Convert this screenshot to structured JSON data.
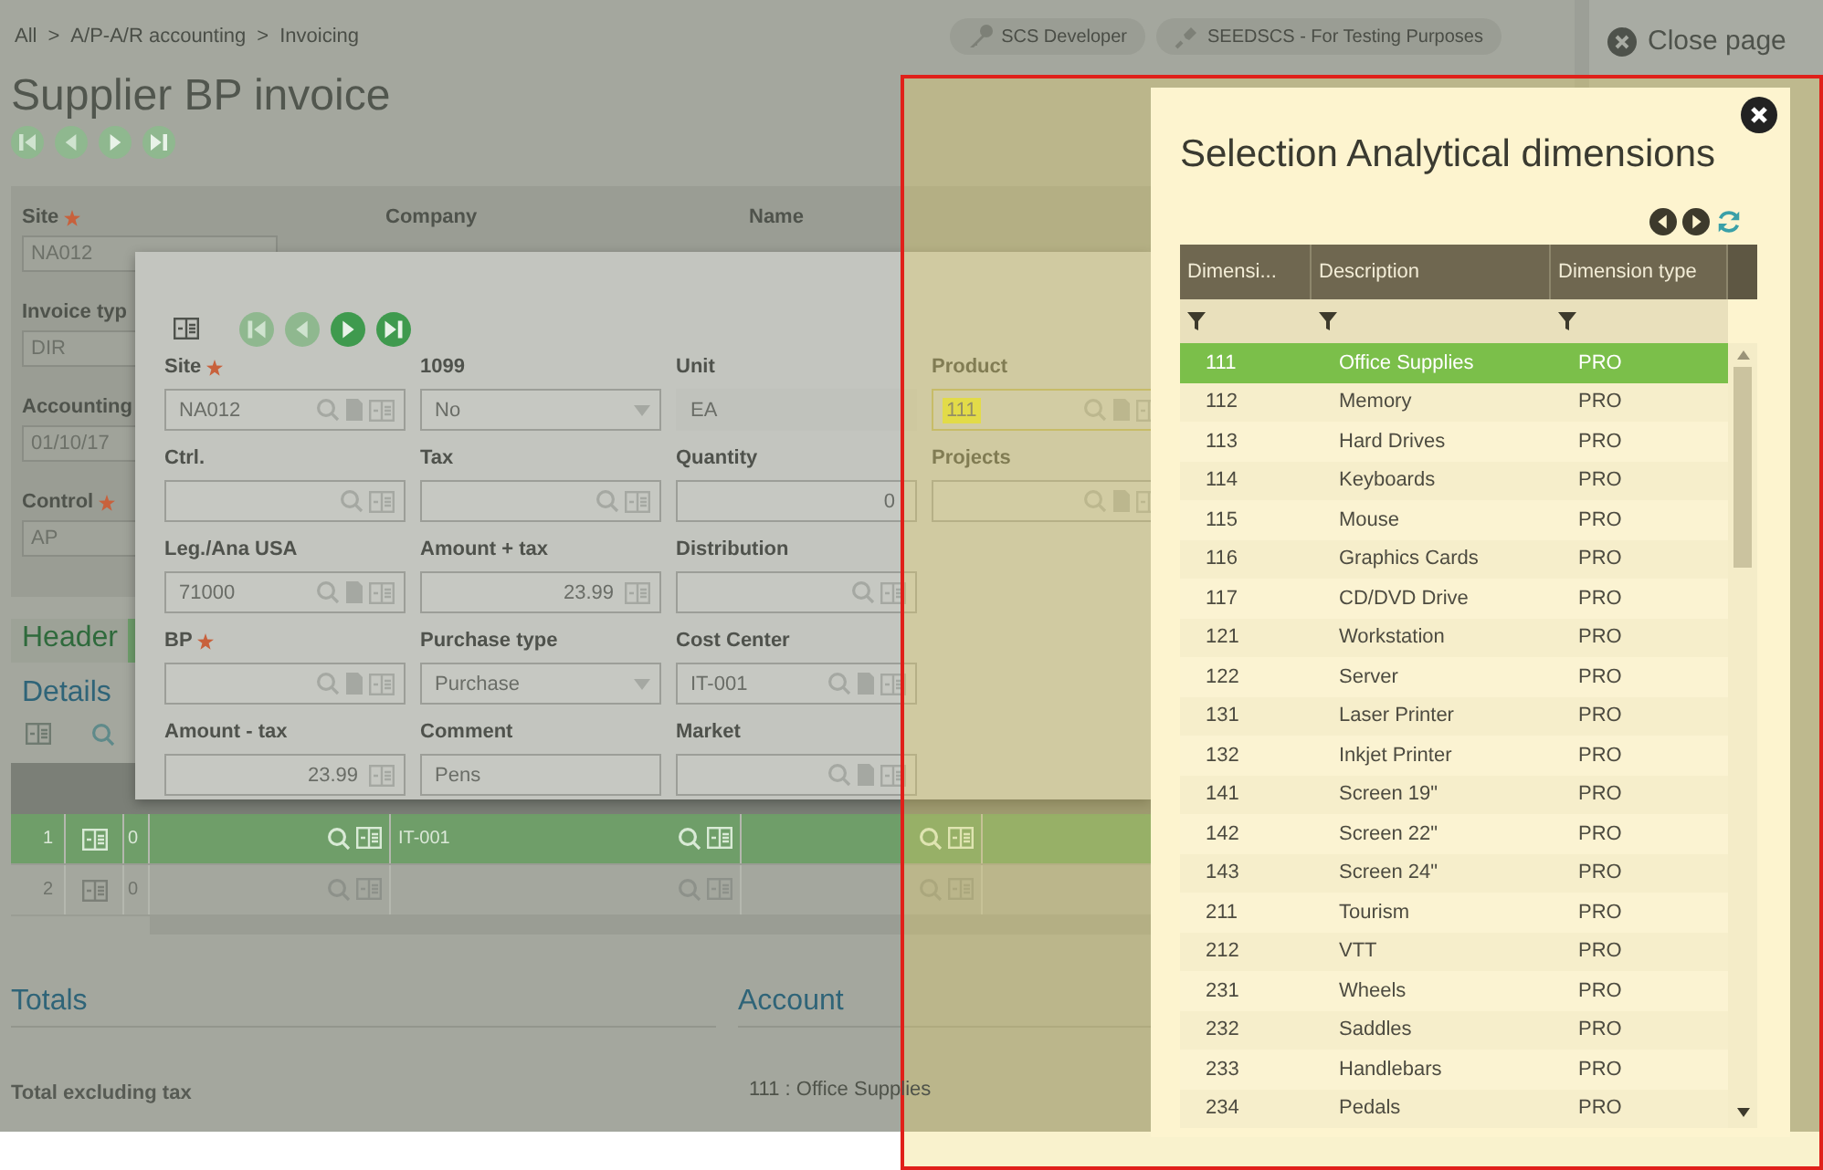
{
  "breadcrumb": {
    "separator": ">",
    "items": [
      "All",
      "A/P-A/R accounting",
      "Invoicing"
    ]
  },
  "user_chips": [
    {
      "label": "SCS Developer",
      "kind": "key"
    },
    {
      "label": "SEEDSCS - For Testing Purposes",
      "kind": "plug"
    }
  ],
  "close_page": "Close page",
  "title": "Supplier BP invoice",
  "form": {
    "top_fields": [
      {
        "label": "Site",
        "required": true,
        "value": "NA012"
      },
      {
        "label": "Company",
        "required": false
      },
      {
        "label": "Name",
        "required": false
      }
    ],
    "left_fields": [
      {
        "label": "Invoice typ",
        "value": "DIR"
      },
      {
        "label": "Accounting",
        "value": "01/10/17"
      },
      {
        "label": "Control",
        "required": true,
        "value": "AP"
      }
    ]
  },
  "header_tab": "Header",
  "details_title": "Details",
  "grid": {
    "rows": [
      {
        "number": "1",
        "selected": true,
        "cells": [
          "0",
          null,
          "IT-001",
          null
        ]
      },
      {
        "number": "2",
        "selected": false,
        "cells": [
          "0",
          null,
          null,
          null
        ]
      }
    ]
  },
  "totals": {
    "title": "Totals",
    "label": "Total excluding tax"
  },
  "account": {
    "title": "Account",
    "value": "111 : Office Supplies"
  },
  "dialog": {
    "rows": [
      [
        {
          "label": "Site",
          "required": true,
          "kind": "lookup",
          "value": "NA012",
          "highlighted": false
        },
        {
          "label": "1099",
          "required": false,
          "kind": "select",
          "value": "No",
          "highlighted": false
        },
        {
          "label": "Unit",
          "required": false,
          "kind": "readonly",
          "value": "EA",
          "highlighted": false
        },
        {
          "label": "Product",
          "required": false,
          "kind": "lookup",
          "value": "111",
          "highlighted": true
        }
      ],
      [
        {
          "label": "Ctrl.",
          "required": false,
          "kind": "search",
          "highlighted": false
        },
        {
          "label": "Tax",
          "required": false,
          "kind": "search",
          "highlighted": false
        },
        {
          "label": "Quantity",
          "required": false,
          "kind": "number",
          "value": "0",
          "highlighted": false
        },
        {
          "label": "Projects",
          "required": false,
          "kind": "lookup",
          "highlighted": false
        }
      ],
      [
        {
          "label": "Leg./Ana USA",
          "required": false,
          "kind": "lookup",
          "value": "71000",
          "highlighted": false
        },
        {
          "label": "Amount + tax",
          "required": false,
          "kind": "amount",
          "value": "23.99",
          "highlighted": false
        },
        {
          "label": "Distribution",
          "required": false,
          "kind": "search",
          "highlighted": false
        }
      ],
      [
        {
          "label": "BP",
          "required": true,
          "kind": "lookup",
          "highlighted": false
        },
        {
          "label": "Purchase type",
          "required": false,
          "kind": "select",
          "value": "Purchase",
          "highlighted": false
        },
        {
          "label": "Cost Center",
          "required": false,
          "kind": "lookup",
          "value": "IT-001",
          "highlighted": false
        }
      ],
      [
        {
          "label": "Amount - tax",
          "required": false,
          "kind": "amount",
          "value": "23.99",
          "highlighted": false
        },
        {
          "label": "Comment",
          "required": false,
          "kind": "text",
          "value": "Pens",
          "highlighted": false
        },
        {
          "label": "Market",
          "required": false,
          "kind": "lookup",
          "highlighted": false
        }
      ]
    ]
  },
  "popup": {
    "title": "Selection Analytical dimensions",
    "columns": [
      "Dimensi...",
      "Description",
      "Dimension type"
    ],
    "rows": [
      {
        "code": "111",
        "description": "Office Supplies",
        "type": "PRO",
        "selected": true
      },
      {
        "code": "112",
        "description": "Memory",
        "type": "PRO",
        "selected": false
      },
      {
        "code": "113",
        "description": "Hard Drives",
        "type": "PRO",
        "selected": false
      },
      {
        "code": "114",
        "description": "Keyboards",
        "type": "PRO",
        "selected": false
      },
      {
        "code": "115",
        "description": "Mouse",
        "type": "PRO",
        "selected": false
      },
      {
        "code": "116",
        "description": "Graphics Cards",
        "type": "PRO",
        "selected": false
      },
      {
        "code": "117",
        "description": "CD/DVD Drive",
        "type": "PRO",
        "selected": false
      },
      {
        "code": "121",
        "description": "Workstation",
        "type": "PRO",
        "selected": false
      },
      {
        "code": "122",
        "description": "Server",
        "type": "PRO",
        "selected": false
      },
      {
        "code": "131",
        "description": "Laser Printer",
        "type": "PRO",
        "selected": false
      },
      {
        "code": "132",
        "description": "Inkjet Printer",
        "type": "PRO",
        "selected": false
      },
      {
        "code": "141",
        "description": "Screen 19\"",
        "type": "PRO",
        "selected": false
      },
      {
        "code": "142",
        "description": "Screen 22\"",
        "type": "PRO",
        "selected": false
      },
      {
        "code": "143",
        "description": "Screen 24\"",
        "type": "PRO",
        "selected": false
      },
      {
        "code": "211",
        "description": "Tourism",
        "type": "PRO",
        "selected": false
      },
      {
        "code": "212",
        "description": "VTT",
        "type": "PRO",
        "selected": false
      },
      {
        "code": "231",
        "description": "Wheels",
        "type": "PRO",
        "selected": false
      },
      {
        "code": "232",
        "description": "Saddles",
        "type": "PRO",
        "selected": false
      },
      {
        "code": "233",
        "description": "Handlebars",
        "type": "PRO",
        "selected": false
      },
      {
        "code": "234",
        "description": "Pedals",
        "type": "PRO",
        "selected": false
      }
    ]
  }
}
